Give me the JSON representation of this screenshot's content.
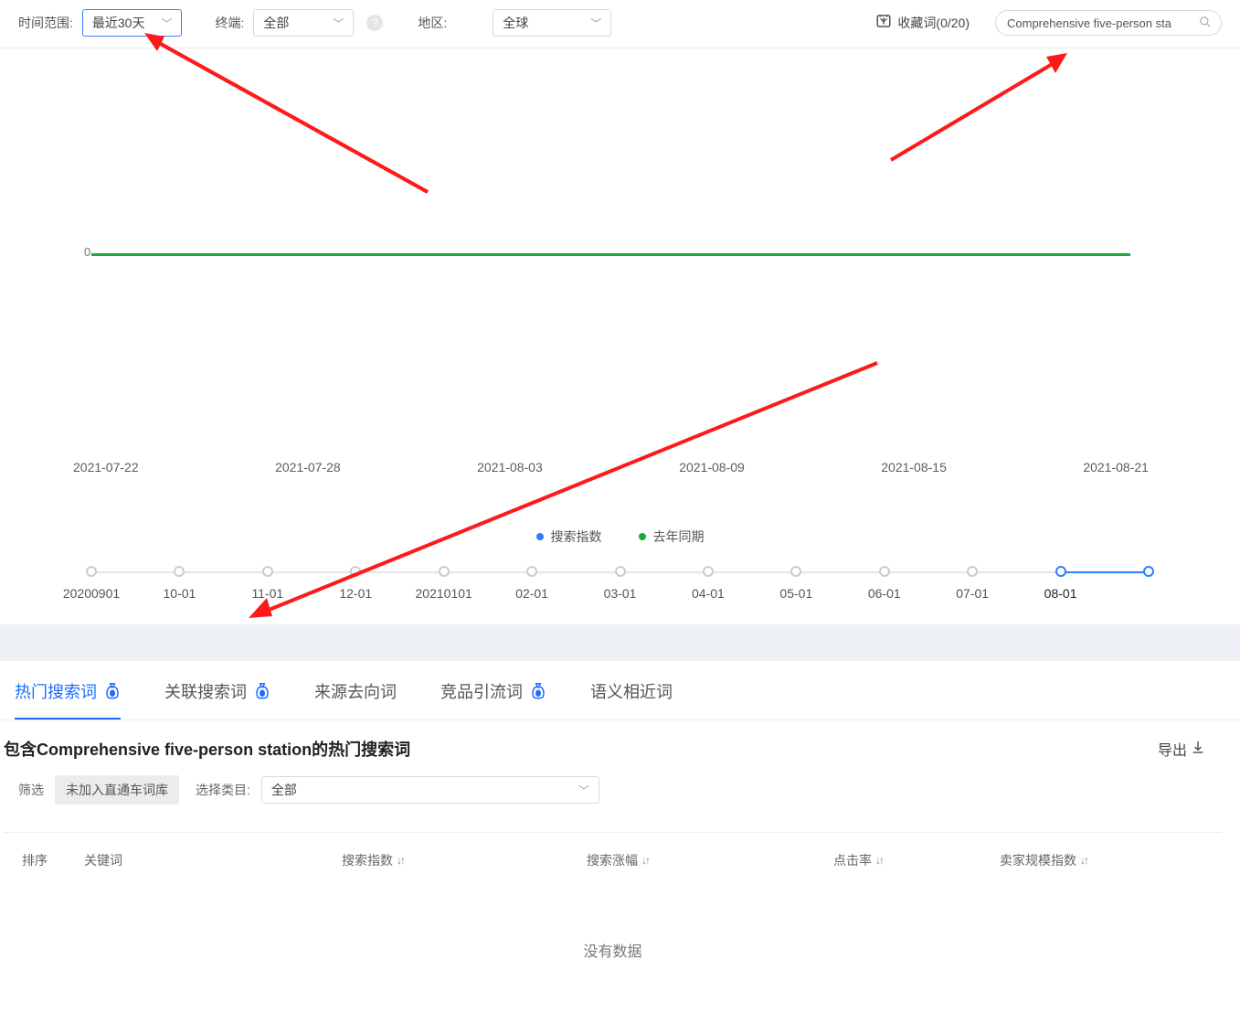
{
  "filters": {
    "time_label": "时间范围:",
    "time_value": "最近30天",
    "terminal_label": "终端:",
    "terminal_value": "全部",
    "region_label": "地区:",
    "region_value": "全球"
  },
  "favorites": {
    "label": "收藏词(0/20)"
  },
  "search": {
    "value": "Comprehensive five-person sta"
  },
  "chart_data": {
    "type": "line",
    "title": "",
    "xlabel": "",
    "ylabel": "",
    "ylim": [
      0,
      0
    ],
    "x": [
      "2021-07-22",
      "2021-07-28",
      "2021-08-03",
      "2021-08-09",
      "2021-08-15",
      "2021-08-21"
    ],
    "series": [
      {
        "name": "搜索指数",
        "color": "#2f7eff",
        "values": [
          null,
          null,
          null,
          null,
          null,
          null
        ]
      },
      {
        "name": "去年同期",
        "color": "#1eab3d",
        "values": [
          0,
          0,
          0,
          0,
          0,
          0
        ]
      }
    ],
    "y_axis_ticks": [
      "0"
    ]
  },
  "mini_timeline": {
    "ticks": [
      "20200901",
      "10-01",
      "11-01",
      "12-01",
      "20210101",
      "02-01",
      "03-01",
      "04-01",
      "05-01",
      "06-01",
      "07-01",
      "08-01",
      ""
    ],
    "active_start_index": 11,
    "active_end_index": 12
  },
  "tabs": {
    "t0": "热门搜索词",
    "t1": "关联搜索词",
    "t2": "来源去向词",
    "t3": "竞品引流词",
    "t4": "语义相近词"
  },
  "section": {
    "title": "包含Comprehensive five-person station的热门搜索词",
    "export": "导出",
    "filter_label": "筛选",
    "filter_pill": "未加入直通车词库",
    "select_label": "选择类目:",
    "select_value": "全部"
  },
  "table": {
    "h0": "排序",
    "h1": "关键词",
    "h2": "搜索指数",
    "h3": "搜索涨幅",
    "h4": "点击率",
    "h5": "卖家规模指数",
    "nodata": "没有数据"
  }
}
